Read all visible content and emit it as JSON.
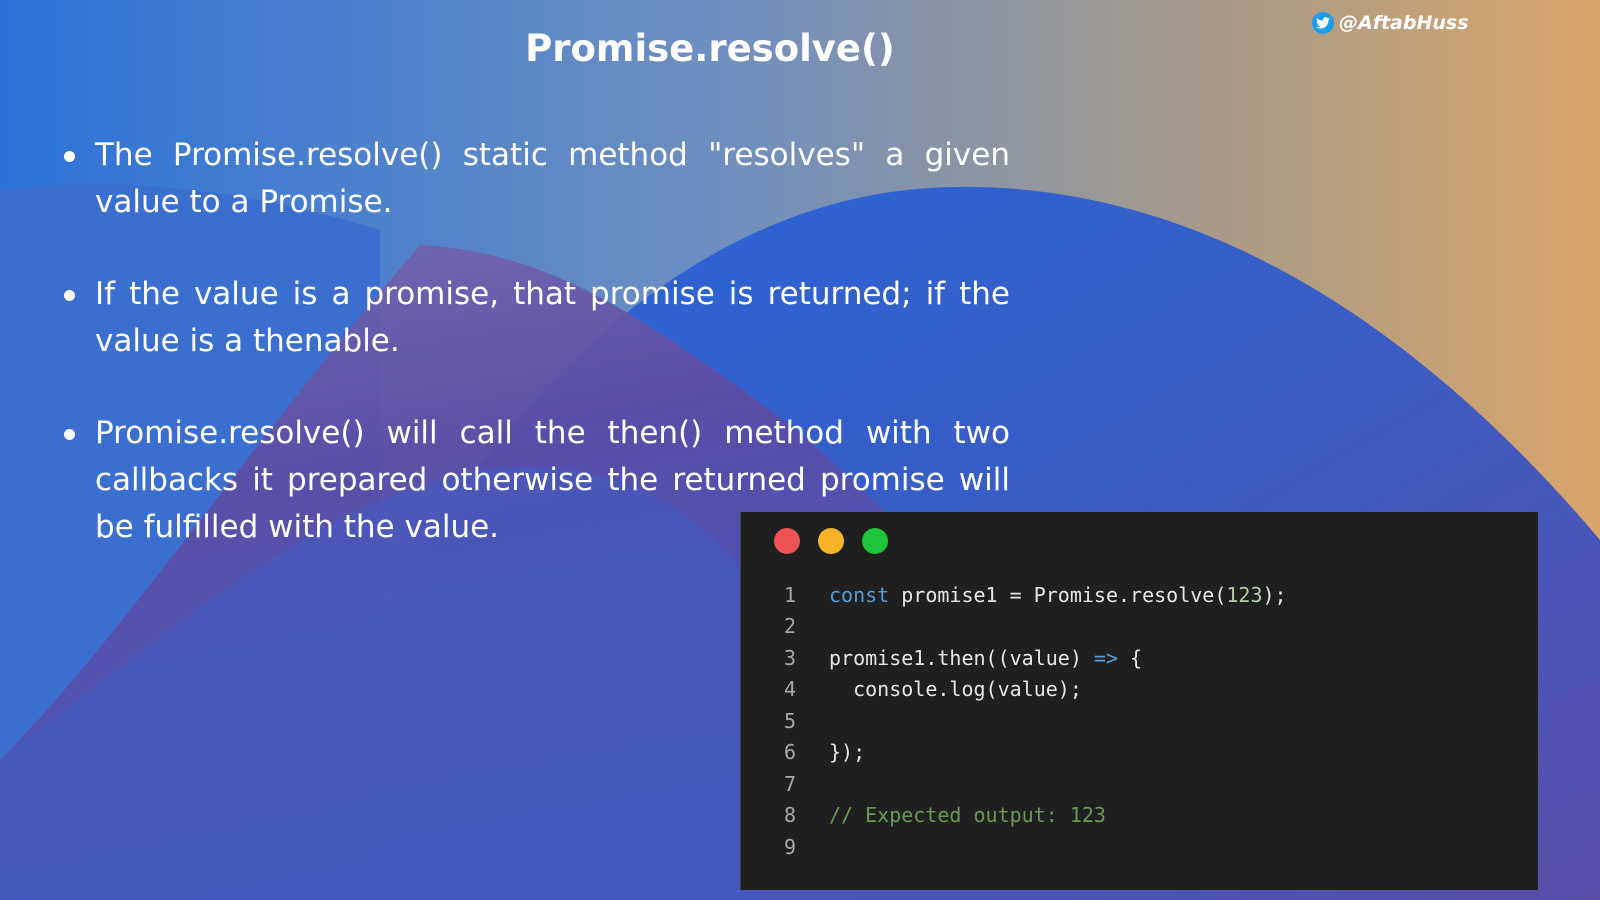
{
  "slide": {
    "title": "Promise.resolve()",
    "handle": "@AftabHuss",
    "handle_icon": "twitter-bird-icon",
    "bullets": [
      "The Promise.resolve() static method \"resolves\" a given value to a Promise.",
      "If the value is a promise, that promise is returned; if the value is a thenable.",
      "Promise.resolve() will call the then() method with two callbacks it prepared otherwise the returned promise will be fulfilled with the value."
    ]
  },
  "code_window": {
    "window_controls": [
      {
        "name": "close",
        "color": "#ee5253"
      },
      {
        "name": "minimize",
        "color": "#f5b326"
      },
      {
        "name": "maximize",
        "color": "#1ec43a"
      }
    ],
    "lines": [
      {
        "n": "1",
        "text": "const promise1 = Promise.resolve(123);"
      },
      {
        "n": "2",
        "text": ""
      },
      {
        "n": "3",
        "text": "promise1.then((value) => {"
      },
      {
        "n": "4",
        "text": "  console.log(value);"
      },
      {
        "n": "5",
        "text": ""
      },
      {
        "n": "6",
        "text": "});"
      },
      {
        "n": "7",
        "text": ""
      },
      {
        "n": "8",
        "text": "// Expected output: 123"
      },
      {
        "n": "9",
        "text": ""
      }
    ]
  },
  "colors": {
    "background_blue": "#2a6fdb",
    "background_orange": "#d6a468",
    "blob_purple": "#6a4a9e",
    "code_background": "#1f1f1f",
    "keyword": "#569cd6",
    "number": "#b5cea8",
    "comment": "#6a9955"
  }
}
